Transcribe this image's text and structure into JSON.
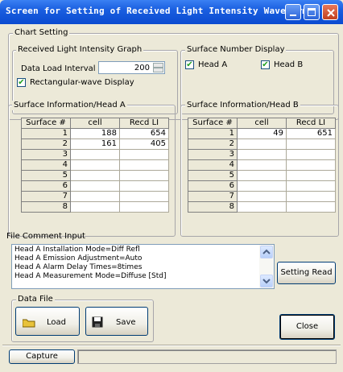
{
  "window": {
    "title": "Screen for Setting of Received Light Intensity Waveform"
  },
  "chart_setting": {
    "title": "Chart Setting",
    "graph_group": {
      "title": "Received Light Intensity Graph",
      "interval_label": "Data Load Interval",
      "interval_value": "200",
      "rect_label": "Rectangular-wave Display",
      "rect_checked": true
    },
    "surface_display": {
      "title": "Surface Number Display",
      "head_a_label": "Head A",
      "head_b_label": "Head B",
      "head_a_checked": true,
      "head_b_checked": true
    }
  },
  "head_a": {
    "title": "Surface Information/Head A",
    "columns": [
      "Surface #",
      "cell",
      "Recd LI"
    ],
    "rows": [
      [
        "1",
        "188",
        "654"
      ],
      [
        "2",
        "161",
        "405"
      ],
      [
        "3",
        "",
        ""
      ],
      [
        "4",
        "",
        ""
      ],
      [
        "5",
        "",
        ""
      ],
      [
        "6",
        "",
        ""
      ],
      [
        "7",
        "",
        ""
      ],
      [
        "8",
        "",
        ""
      ]
    ]
  },
  "head_b": {
    "title": "Surface Information/Head B",
    "columns": [
      "Surface #",
      "cell",
      "Recd LI"
    ],
    "rows": [
      [
        "1",
        "49",
        "651"
      ],
      [
        "2",
        "",
        ""
      ],
      [
        "3",
        "",
        ""
      ],
      [
        "4",
        "",
        ""
      ],
      [
        "5",
        "",
        ""
      ],
      [
        "6",
        "",
        ""
      ],
      [
        "7",
        "",
        ""
      ],
      [
        "8",
        "",
        ""
      ]
    ]
  },
  "comment": {
    "label": "File Comment Input",
    "lines": [
      "Head A Installation Mode=Diff Refl",
      "Head A Emission Adjustment=Auto",
      "Head A Alarm Delay Times=8times",
      "Head A Measurement Mode=Diffuse [Std]"
    ]
  },
  "buttons": {
    "setting_read": "Setting Read",
    "load": "Load",
    "save": "Save",
    "close": "Close",
    "capture": "Capture"
  },
  "data_file": {
    "title": "Data File"
  },
  "icons": {
    "folder": "folder-icon",
    "save": "floppy-disk-icon",
    "minimize": "minimize-icon",
    "maximize": "maximize-icon",
    "close": "close-icon"
  },
  "colors": {
    "titlebar": "#0a4ad0",
    "check": "#21a121",
    "face": "#ece9d8"
  }
}
